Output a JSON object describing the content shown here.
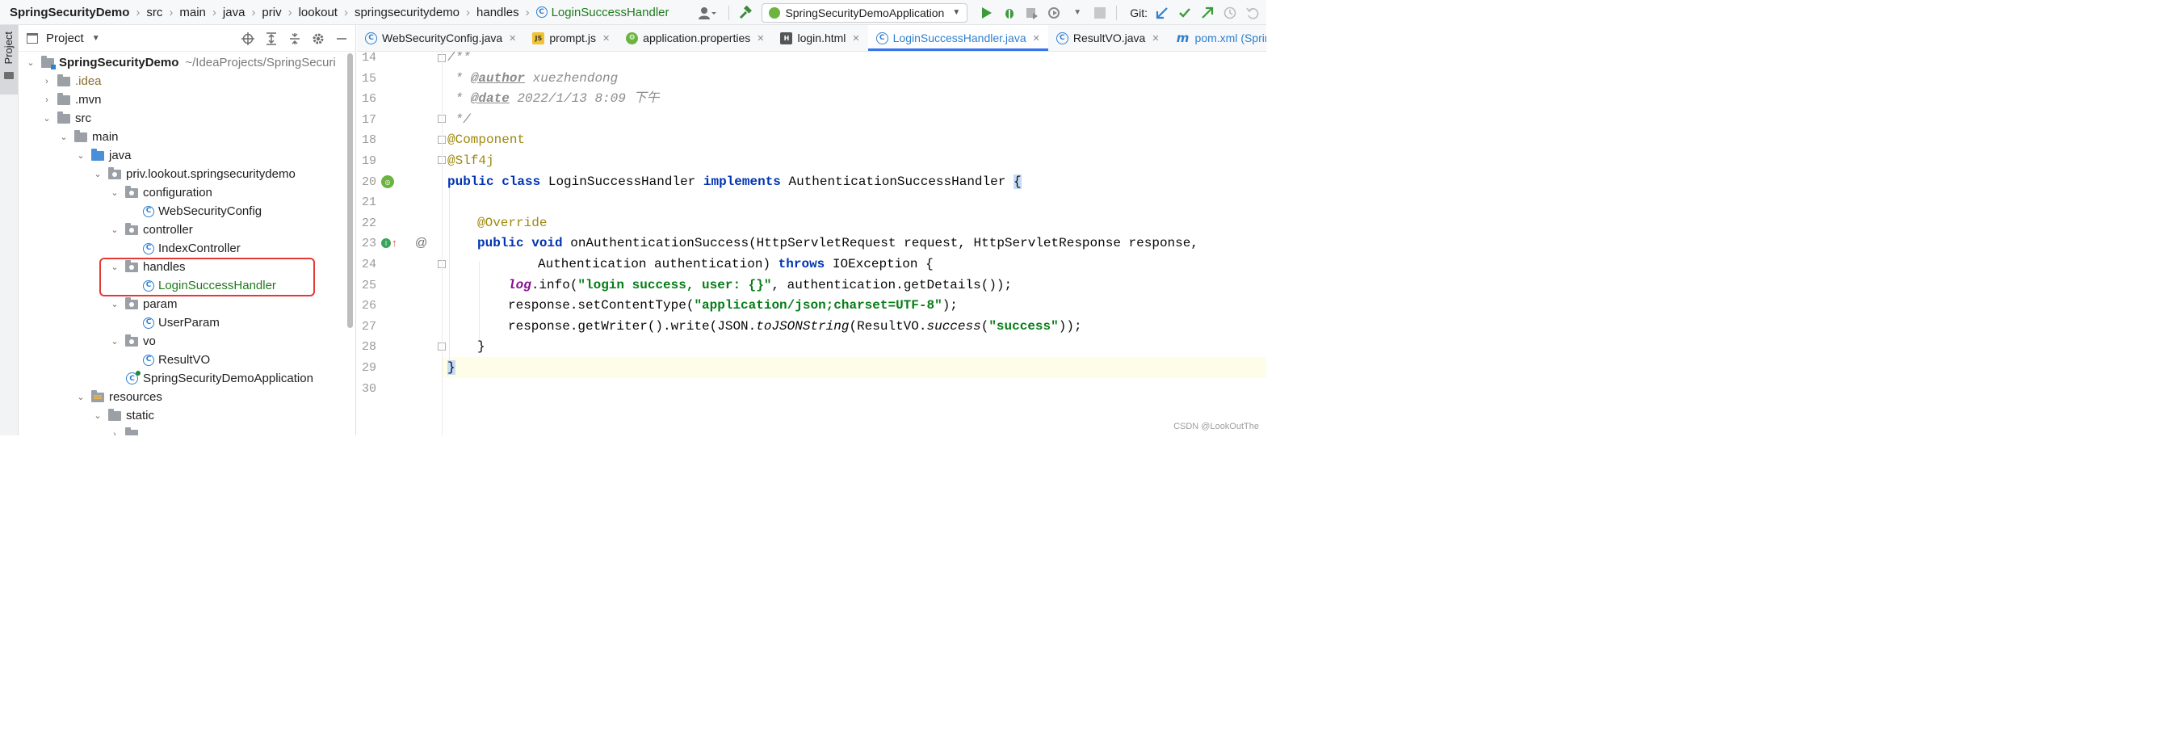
{
  "breadcrumbs": [
    "SpringSecurityDemo",
    "src",
    "main",
    "java",
    "priv",
    "lookout",
    "springsecuritydemo",
    "handles",
    "LoginSuccessHandler"
  ],
  "toolbar": {
    "run_config": "SpringSecurityDemoApplication",
    "git_label": "Git:"
  },
  "tool_stripe": {
    "label": "Project"
  },
  "project_panel": {
    "title": "Project",
    "tree": [
      {
        "label": "SpringSecurityDemo",
        "hint": "~/IdeaProjects/SpringSecuri"
      },
      {
        "label": ".idea"
      },
      {
        "label": ".mvn"
      },
      {
        "label": "src"
      },
      {
        "label": "main"
      },
      {
        "label": "java"
      },
      {
        "label": "priv.lookout.springsecuritydemo"
      },
      {
        "label": "configuration"
      },
      {
        "label": "WebSecurityConfig"
      },
      {
        "label": "controller"
      },
      {
        "label": "IndexController"
      },
      {
        "label": "handles"
      },
      {
        "label": "LoginSuccessHandler"
      },
      {
        "label": "param"
      },
      {
        "label": "UserParam"
      },
      {
        "label": "vo"
      },
      {
        "label": "ResultVO"
      },
      {
        "label": "SpringSecurityDemoApplication"
      },
      {
        "label": "resources"
      },
      {
        "label": "static"
      }
    ]
  },
  "editor_tabs": [
    {
      "label": "WebSecurityConfig.java",
      "icon": "class-icon"
    },
    {
      "label": "prompt.js",
      "icon": "js-file-icon"
    },
    {
      "label": "application.properties",
      "icon": "properties-file-icon"
    },
    {
      "label": "login.html",
      "icon": "html-file-icon"
    },
    {
      "label": "LoginSuccessHandler.java",
      "icon": "class-icon",
      "active": true
    },
    {
      "label": "ResultVO.java",
      "icon": "class-icon"
    },
    {
      "label": "pom.xml (SpringSecurityDemo)",
      "icon": "maven-icon"
    }
  ],
  "editor": {
    "line_numbers": [
      "14",
      "15",
      "16",
      "17",
      "18",
      "19",
      "20",
      "21",
      "22",
      "23",
      "24",
      "25",
      "26",
      "27",
      "28",
      "29",
      "30"
    ],
    "current_line": "29",
    "code": {
      "l14": "/**",
      "l15_star": " * ",
      "l15_tag": "@author",
      "l15_text": " xuezhendong",
      "l16_star": " * ",
      "l16_tag": "@date",
      "l16_text": " 2022/1/13 8:09 下午",
      "l17": " */",
      "l18": "@Component",
      "l19": "@Slf4j",
      "l20_kw1": "public",
      "l20_kw2": "class",
      "l20_name": " LoginSuccessHandler ",
      "l20_kw3": "implements",
      "l20_iface": " AuthenticationSuccessHandler ",
      "l20_brace": "{",
      "l22": "@Override",
      "l23_kw1": "public",
      "l23_kw2": "void",
      "l23_rest": " onAuthenticationSuccess(HttpServletRequest request, HttpServletResponse response,",
      "l24_text": "Authentication authentication) ",
      "l24_kw": "throws",
      "l24_rest": " IOException {",
      "l25_field": "log",
      "l25_a": ".info(",
      "l25_str": "\"login success, user: {}\"",
      "l25_b": ", authentication.getDetails());",
      "l26_a": "response.setContentType(",
      "l26_str": "\"application/json;charset=UTF-8\"",
      "l26_b": ");",
      "l27_a": "response.getWriter().write(JSON.",
      "l27_m1": "toJSONString",
      "l27_b": "(ResultVO.",
      "l27_m2": "success",
      "l27_c": "(",
      "l27_str": "\"success\"",
      "l27_d": "));",
      "l28": "}",
      "l29": "}"
    }
  },
  "watermark": "CSDN @LookOutThe"
}
